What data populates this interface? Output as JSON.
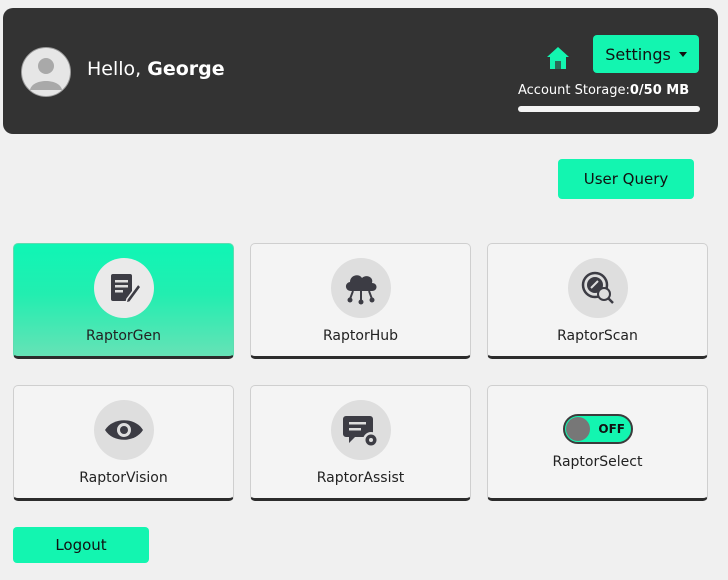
{
  "header": {
    "greeting_prefix": "Hello, ",
    "user_name": "George",
    "settings_label": "Settings",
    "storage_label": "Account Storage:",
    "storage_value": "0/50 MB",
    "storage_used_fraction": 0.0
  },
  "actions": {
    "user_query_label": "User Query",
    "logout_label": "Logout"
  },
  "apps": [
    {
      "label": "RaptorGen",
      "icon": "document-edit-icon",
      "active": true
    },
    {
      "label": "RaptorHub",
      "icon": "cloud-network-icon",
      "active": false
    },
    {
      "label": "RaptorScan",
      "icon": "magnify-scan-icon",
      "active": false
    },
    {
      "label": "RaptorVision",
      "icon": "eye-icon",
      "active": false
    },
    {
      "label": "RaptorAssist",
      "icon": "chat-gear-icon",
      "active": false
    },
    {
      "label": "RaptorSelect",
      "toggle_state": "OFF",
      "active": false
    }
  ],
  "colors": {
    "accent": "#13f5b0",
    "header_bg": "#333333",
    "page_bg": "#f0f0f0",
    "icon_dark": "#3c3c44"
  }
}
